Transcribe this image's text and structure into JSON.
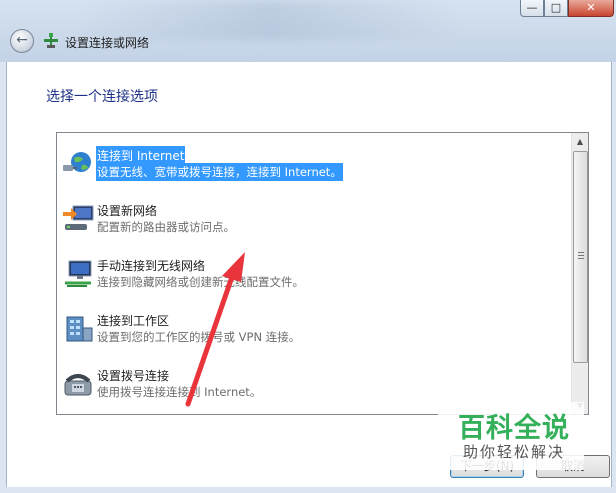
{
  "window": {
    "title": "设置连接或网络",
    "controls": {
      "minimize": "—",
      "maximize": "□",
      "close": "✕"
    }
  },
  "heading": "选择一个连接选项",
  "options": [
    {
      "title": "连接到 Internet",
      "desc": "设置无线、宽带或拨号连接，连接到 Internet。",
      "icon": "globe-network-icon",
      "selected": true
    },
    {
      "title": "设置新网络",
      "desc": "配置新的路由器或访问点。",
      "icon": "router-setup-icon",
      "selected": false
    },
    {
      "title": "手动连接到无线网络",
      "desc": "连接到隐藏网络或创建新无线配置文件。",
      "icon": "wireless-monitor-icon",
      "selected": false
    },
    {
      "title": "连接到工作区",
      "desc": "设置到您的工作区的拨号或 VPN 连接。",
      "icon": "workplace-building-icon",
      "selected": false
    },
    {
      "title": "设置拨号连接",
      "desc": "使用拨号连接连接到 Internet。",
      "icon": "dialup-phone-icon",
      "selected": false
    }
  ],
  "buttons": {
    "next": "下一步(N)",
    "cancel": "取消"
  },
  "watermark": {
    "brand": "百科全说",
    "tagline": "助你轻松解决"
  },
  "colors": {
    "selection": "#3399ff",
    "heading": "#1e3287",
    "annotation_arrow": "#e8343a",
    "watermark_green": "#35b05a"
  }
}
